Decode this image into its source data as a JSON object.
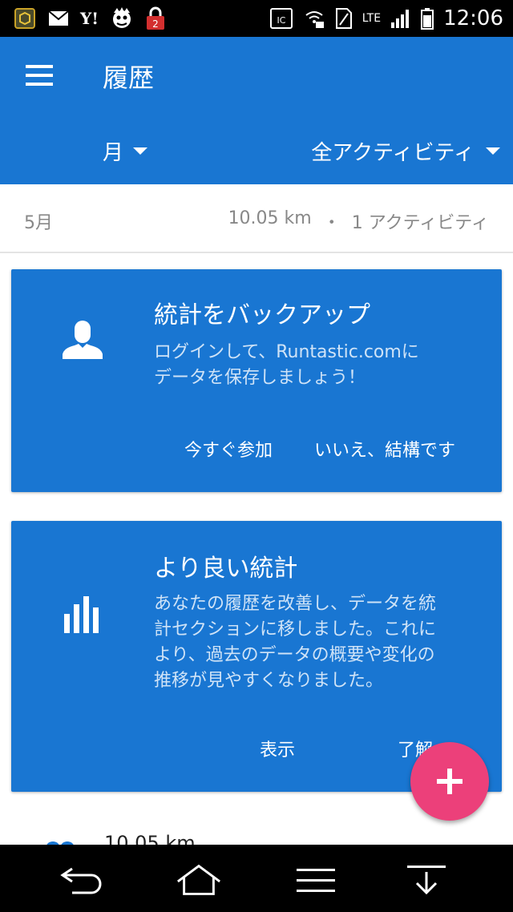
{
  "status_bar": {
    "time": "12:06",
    "network": "LTE",
    "left_icons": [
      "box-icon",
      "mail-icon",
      "yahoo-icon",
      "mascot-icon",
      "lock-badge-icon"
    ],
    "lock_badge_count": "2",
    "yahoo_label": "Y!",
    "right_icons": [
      "nfc-icon",
      "wifi-lock-icon",
      "sim-icon",
      "signal-icon",
      "battery-icon"
    ]
  },
  "app_bar": {
    "title": "履歴",
    "period_filter": "月",
    "activity_filter": "全アクティビティ"
  },
  "summary": {
    "month": "5月",
    "distance": "10.05 km",
    "separator": "・",
    "activity_count": "1 アクティビティ"
  },
  "cards": [
    {
      "icon": "person-icon",
      "title": "統計をバックアップ",
      "body_lines": [
        "ログインして、Runtastic.comに",
        "データを保存しましょう！"
      ],
      "actions": [
        "今すぐ参加",
        "いいえ、結構です"
      ]
    },
    {
      "icon": "bar-chart-icon",
      "title": "より良い統計",
      "body_lines": [
        "あなたの履歴を改善し、データを統",
        "計セクションに移しました。これに",
        "より、過去のデータの概要や変化の",
        "推移が見やすくなりました。"
      ],
      "actions": [
        "表示",
        "了解"
      ]
    }
  ],
  "peek_item": {
    "distance": "10.05 km"
  },
  "fab": {
    "icon": "plus-icon"
  },
  "nav_bar": {
    "buttons": [
      "back-icon",
      "home-icon",
      "menu-icon",
      "notification-drawer-icon"
    ]
  },
  "colors": {
    "primary": "#1976d2",
    "accent": "#ec407a",
    "muted_text": "#888888"
  }
}
